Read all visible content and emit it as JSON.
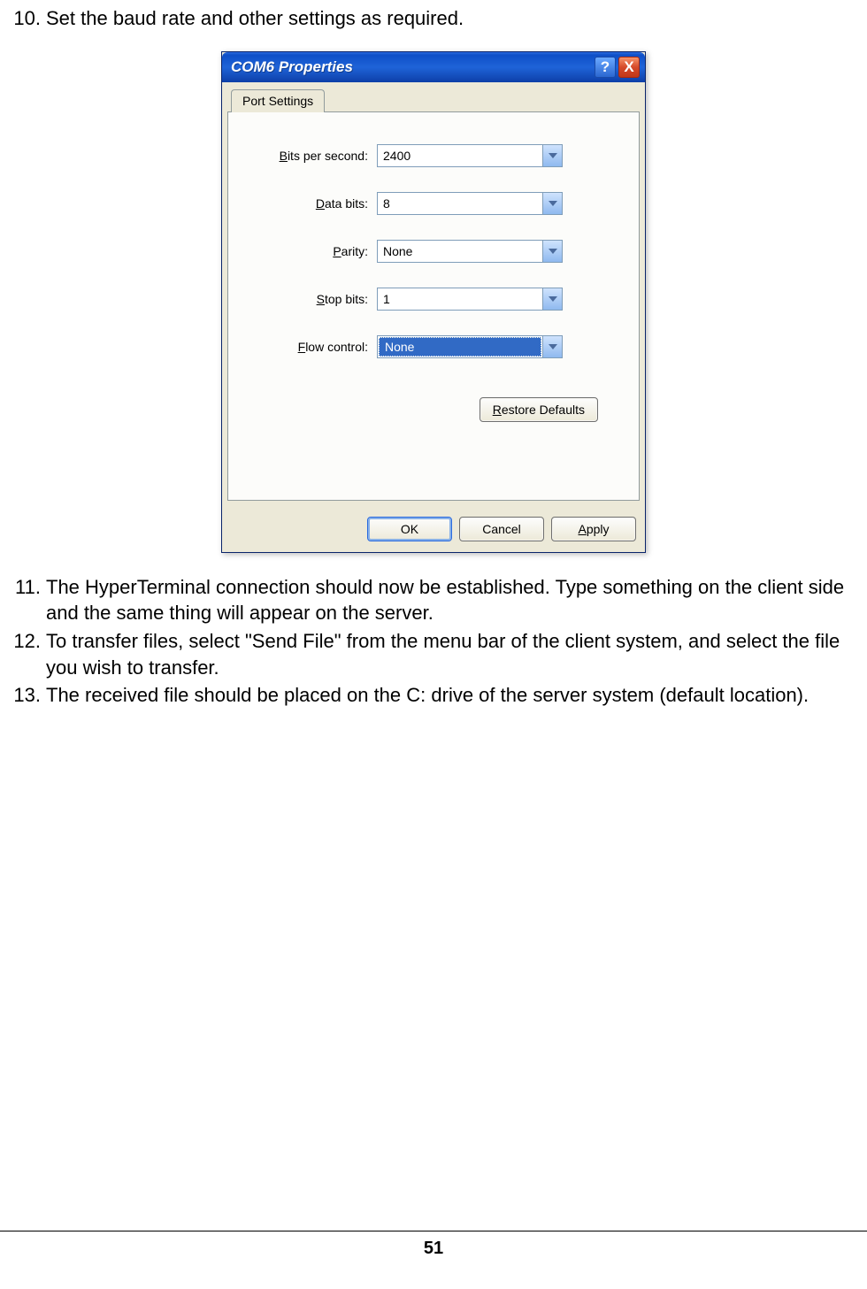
{
  "steps": {
    "n10": "10.",
    "t10": "Set the baud rate and other settings as required.",
    "n11": "11.",
    "t11": "The HyperTerminal connection should now be established. Type something on the client side and the same thing will appear on the server.",
    "n12": "12.",
    "t12": "To transfer files, select \"Send File\" from the menu bar of the client system, and select the file you wish to transfer.",
    "n13": "13.",
    "t13": "The received file should be placed on the C: drive of the server system (default location)."
  },
  "dlg": {
    "title": "COM6 Properties",
    "help": "?",
    "close": "X",
    "tab": "Port Settings",
    "fields": {
      "bits_lbl_pre": "B",
      "bits_lbl_rest": "its per second:",
      "bits_val": "2400",
      "data_lbl_pre": "D",
      "data_lbl_rest": "ata bits:",
      "data_val": "8",
      "par_lbl_pre": "P",
      "par_lbl_rest": "arity:",
      "par_val": "None",
      "stop_lbl_pre": "S",
      "stop_lbl_rest": "top bits:",
      "stop_val": "1",
      "flow_lbl_pre": "F",
      "flow_lbl_rest": "low control:",
      "flow_val": "None"
    },
    "buttons": {
      "restore_pre": "R",
      "restore_rest": "estore Defaults",
      "ok": "OK",
      "cancel": "Cancel",
      "apply_pre": "A",
      "apply_rest": "pply"
    }
  },
  "page_number": "51"
}
